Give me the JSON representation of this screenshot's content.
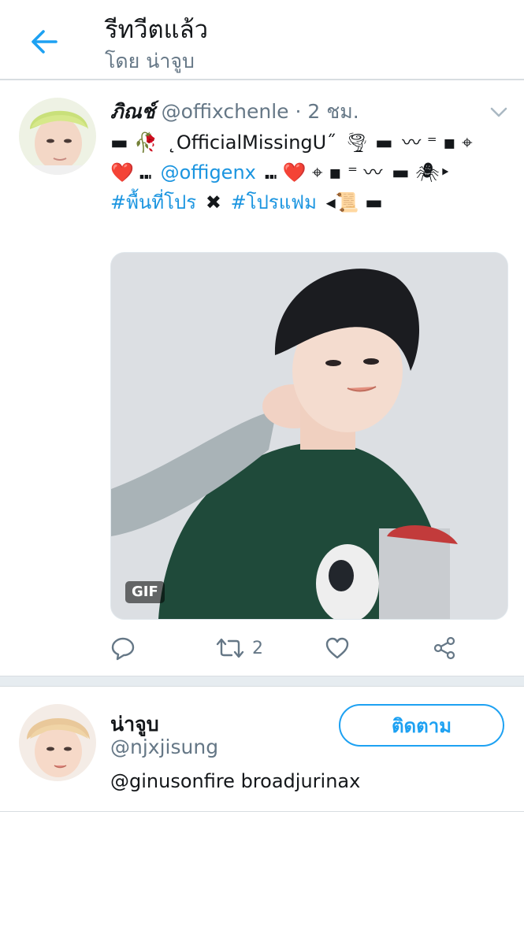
{
  "header": {
    "title": "รีทวีตแล้ว",
    "subtitle": "โดย น่าจูบ",
    "back_icon": "arrow-left-icon"
  },
  "tweet": {
    "author_name": "ภิณช์",
    "author_handle": "@offixchenle",
    "time": "2 ชม.",
    "text_segments": [
      {
        "text": "▬ 🥀",
        "type": "text"
      },
      {
        "text": "˛OfficialMissingU˝",
        "type": "text"
      },
      {
        "text": "🌪 ▬",
        "type": "text"
      },
      {
        "text": "〰 ⁼ ▪ ⌖ ❤️ ⑉",
        "type": "text"
      },
      {
        "text": "@offigenx",
        "type": "link"
      },
      {
        "text": "⑉ ❤️ ⌖ ▪ ⁼ 〰",
        "type": "text"
      },
      {
        "text": "▬ 🕷‣",
        "type": "text"
      },
      {
        "text": "#พื้นที่โปร",
        "type": "link"
      },
      {
        "text": "✖",
        "type": "text"
      },
      {
        "text": "#โปรแฟม",
        "type": "link"
      },
      {
        "text": "◂📜 ▬",
        "type": "text"
      }
    ],
    "media_badge": "GIF",
    "actions": {
      "reply_icon": "reply-icon",
      "retweet_icon": "retweet-icon",
      "retweet_count": "2",
      "like_icon": "heart-icon",
      "share_icon": "share-icon"
    }
  },
  "user_card": {
    "name": "น่าจูบ",
    "handle": "@njxjisung",
    "bio": "@ginusonfire broadjurinax",
    "follow_label": "ติดตาม"
  },
  "colors": {
    "accent": "#1da1f2",
    "link": "#1b95e0",
    "secondary_text": "#657786"
  }
}
